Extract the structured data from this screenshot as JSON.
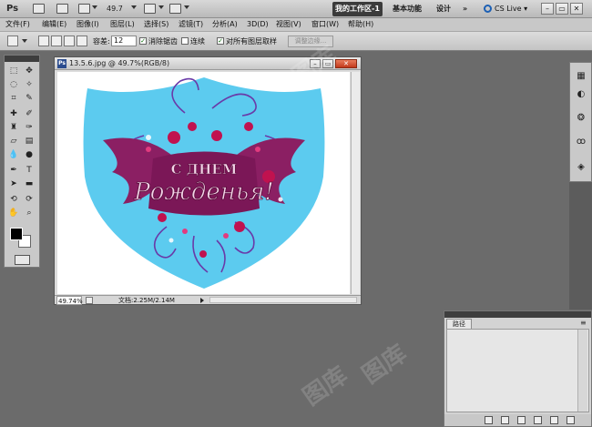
{
  "appbar": {
    "logo": "Ps",
    "zoom_value": "49.7",
    "workspaces": {
      "mine": "我的工作区-1",
      "essentials": "基本功能",
      "design": "设计",
      "more": "»"
    },
    "cslive": "CS Live ▾",
    "win_minimize": "–",
    "win_restore": "▭",
    "win_close": "✕"
  },
  "menu": {
    "items": [
      "文件(F)",
      "编辑(E)",
      "图像(I)",
      "图层(L)",
      "选择(S)",
      "滤镜(T)",
      "分析(A)",
      "3D(D)",
      "视图(V)",
      "窗口(W)",
      "帮助(H)"
    ]
  },
  "options": {
    "tolerance_label": "容差:",
    "tolerance_value": "12",
    "antialias_label": "消除锯齿",
    "contiguous_label": "连续",
    "sample_all_label": "对所有图层取样",
    "refine_edge": "调整边缘...",
    "antialias_checked": true,
    "contiguous_checked": false,
    "sample_all_checked": true
  },
  "document": {
    "title": "13.5.6.jpg @ 49.7%(RGB/8)",
    "zoom": "49.74%",
    "info": "文档:2.25M/2.14M",
    "artwork_text_top": "С ДНЕМ",
    "artwork_text_main": "Рожденья!",
    "colors": {
      "shield": "#5ccbef",
      "wings": "#8b1f63",
      "text_fill": "#f3d6e8",
      "flowers": "#c0124f"
    }
  },
  "panels": {
    "paths_tab": "路径",
    "paths_menu": "≡"
  },
  "watermark": [
    "图库",
    "图库",
    "图库"
  ]
}
